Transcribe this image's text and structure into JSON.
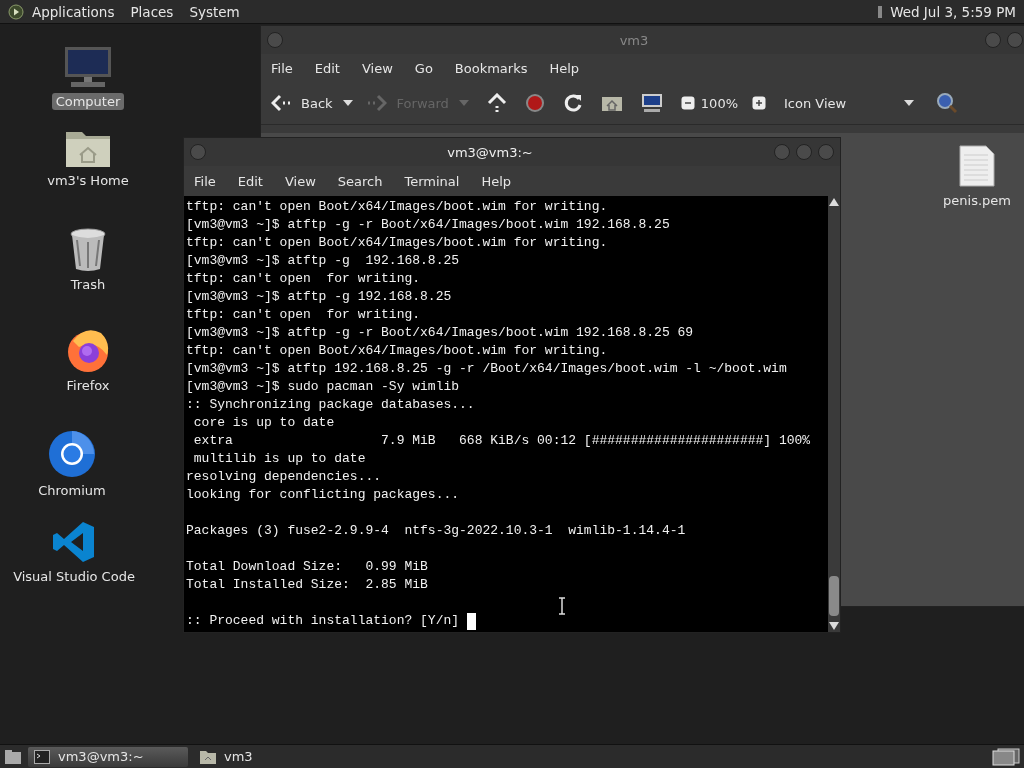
{
  "top_panel": {
    "menus": [
      "Applications",
      "Places",
      "System"
    ],
    "clock": "Wed Jul  3,  5:59 PM"
  },
  "desktop_icons": [
    {
      "kind": "computer",
      "label": "Computer",
      "selected": true
    },
    {
      "kind": "home",
      "label": "vm3's Home",
      "selected": false
    },
    {
      "kind": "trash",
      "label": "Trash",
      "selected": false
    },
    {
      "kind": "firefox",
      "label": "Firefox",
      "selected": false
    },
    {
      "kind": "chromium",
      "label": "Chromium",
      "selected": false
    },
    {
      "kind": "vscode",
      "label": "Visual Studio Code",
      "selected": false
    }
  ],
  "file_manager": {
    "title": "vm3",
    "menu": [
      "File",
      "Edit",
      "View",
      "Go",
      "Bookmarks",
      "Help"
    ],
    "toolbar": {
      "back": "Back",
      "forward": "Forward",
      "forward_disabled": true,
      "zoom": "100%",
      "view": "Icon View"
    },
    "files": [
      {
        "name": "penis.pem"
      }
    ]
  },
  "terminal": {
    "title": "vm3@vm3:~",
    "menu": [
      "File",
      "Edit",
      "View",
      "Search",
      "Terminal",
      "Help"
    ],
    "blocks": [
      [
        "tftp: can't open Boot/x64/Images/boot.wim for writing.",
        "[vm3@vm3 ~]$ atftp -g -r Boot/x64/Images/boot.wim 192.168.8.25",
        "tftp: can't open Boot/x64/Images/boot.wim for writing.",
        "[vm3@vm3 ~]$ atftp -g  192.168.8.25",
        "tftp: can't open  for writing.",
        "[vm3@vm3 ~]$ atftp -g 192.168.8.25",
        "tftp: can't open  for writing.",
        "[vm3@vm3 ~]$ atftp -g -r Boot/x64/Images/boot.wim 192.168.8.25 69",
        "tftp: can't open Boot/x64/Images/boot.wim for writing.",
        "[vm3@vm3 ~]$ atftp 192.168.8.25 -g -r /Boot/x64/Images/boot.wim -l ~/boot.wim",
        "[vm3@vm3 ~]$ sudo pacman -Sy wimlib",
        ":: Synchronizing package databases...",
        " core is up to date",
        " extra                   7.9 MiB   668 KiB/s 00:12 [######################] 100%",
        " multilib is up to date",
        "resolving dependencies...",
        "looking for conflicting packages..."
      ],
      [
        "Packages (3) fuse2-2.9.9-4  ntfs-3g-2022.10.3-1  wimlib-1.14.4-1"
      ],
      [
        "Total Download Size:   0.99 MiB",
        "Total Installed Size:  2.85 MiB"
      ],
      [
        ":: Proceed with installation? [Y/n] "
      ]
    ]
  },
  "taskbar": [
    {
      "kind": "terminal",
      "label": "vm3@vm3:~",
      "selected": true
    },
    {
      "kind": "folder",
      "label": "vm3",
      "selected": false
    }
  ]
}
